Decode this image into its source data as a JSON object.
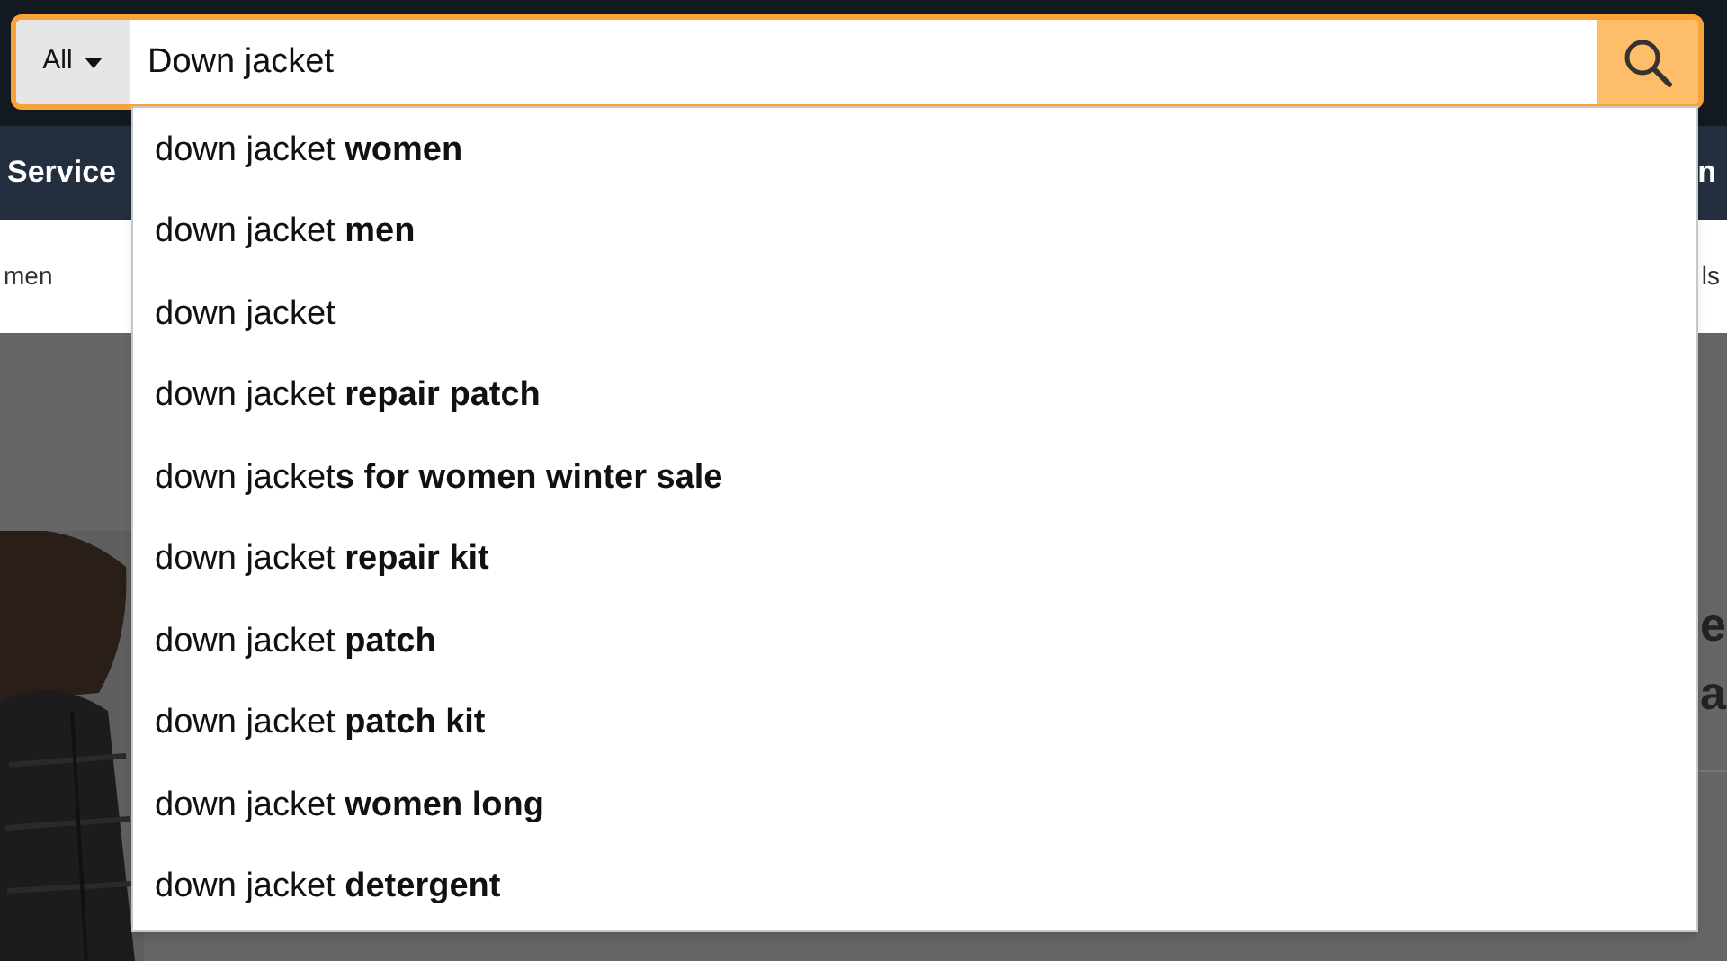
{
  "search": {
    "category": "All",
    "value": "Down jacket"
  },
  "nav_bar": {
    "left_text": "Service",
    "right_text": "n"
  },
  "sub_nav": {
    "left_text": "men",
    "right_text": "ls"
  },
  "background_heading": {
    "line_1": "e",
    "line_2": "a"
  },
  "suggestions": [
    {
      "text": "down jacket **women**"
    },
    {
      "text": "down jacket **men**"
    },
    {
      "text": "down jacket"
    },
    {
      "text": "down jacket **repair patch**"
    },
    {
      "text": "down jacket**s for women winter sale**"
    },
    {
      "text": "down jacket **repair kit**"
    },
    {
      "text": "down jacket **patch**"
    },
    {
      "text": "down jacket **patch kit**"
    },
    {
      "text": "down jacket **women long**"
    },
    {
      "text": "down jacket **detergent**"
    }
  ]
}
